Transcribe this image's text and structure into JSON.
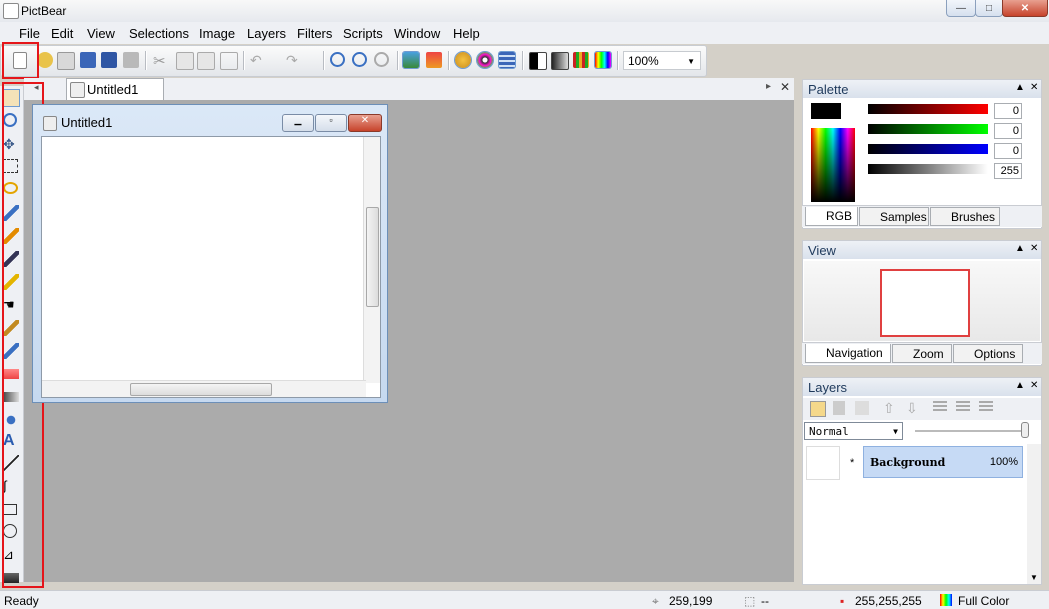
{
  "app": {
    "title": "PictBear"
  },
  "window_controls": {
    "minimize": "—",
    "maximize": "□",
    "close": "✕"
  },
  "menu": [
    "File",
    "Edit",
    "View",
    "Selections",
    "Image",
    "Layers",
    "Filters",
    "Scripts",
    "Window",
    "Help"
  ],
  "toolbar": {
    "zoom_value": "100%"
  },
  "document": {
    "tab_label": "Untitled1",
    "window_title": "Untitled1"
  },
  "palette": {
    "title": "Palette",
    "values": [
      "0",
      "0",
      "0",
      "255"
    ],
    "tabs": [
      "RGB",
      "Samples",
      "Brushes"
    ]
  },
  "view_panel": {
    "title": "View",
    "tabs": [
      "Navigation",
      "Zoom",
      "Options"
    ]
  },
  "layers_panel": {
    "title": "Layers",
    "blend_mode": "Normal",
    "layer": {
      "marker": "*",
      "name": "Background",
      "opacity": "100%"
    }
  },
  "status": {
    "ready": "Ready",
    "coords": "259,199",
    "size": "--",
    "color": "255,255,255",
    "mode": "Full Color"
  },
  "colors": {
    "highlight_box": "#e5151a",
    "selection": "#cfe0f5"
  }
}
